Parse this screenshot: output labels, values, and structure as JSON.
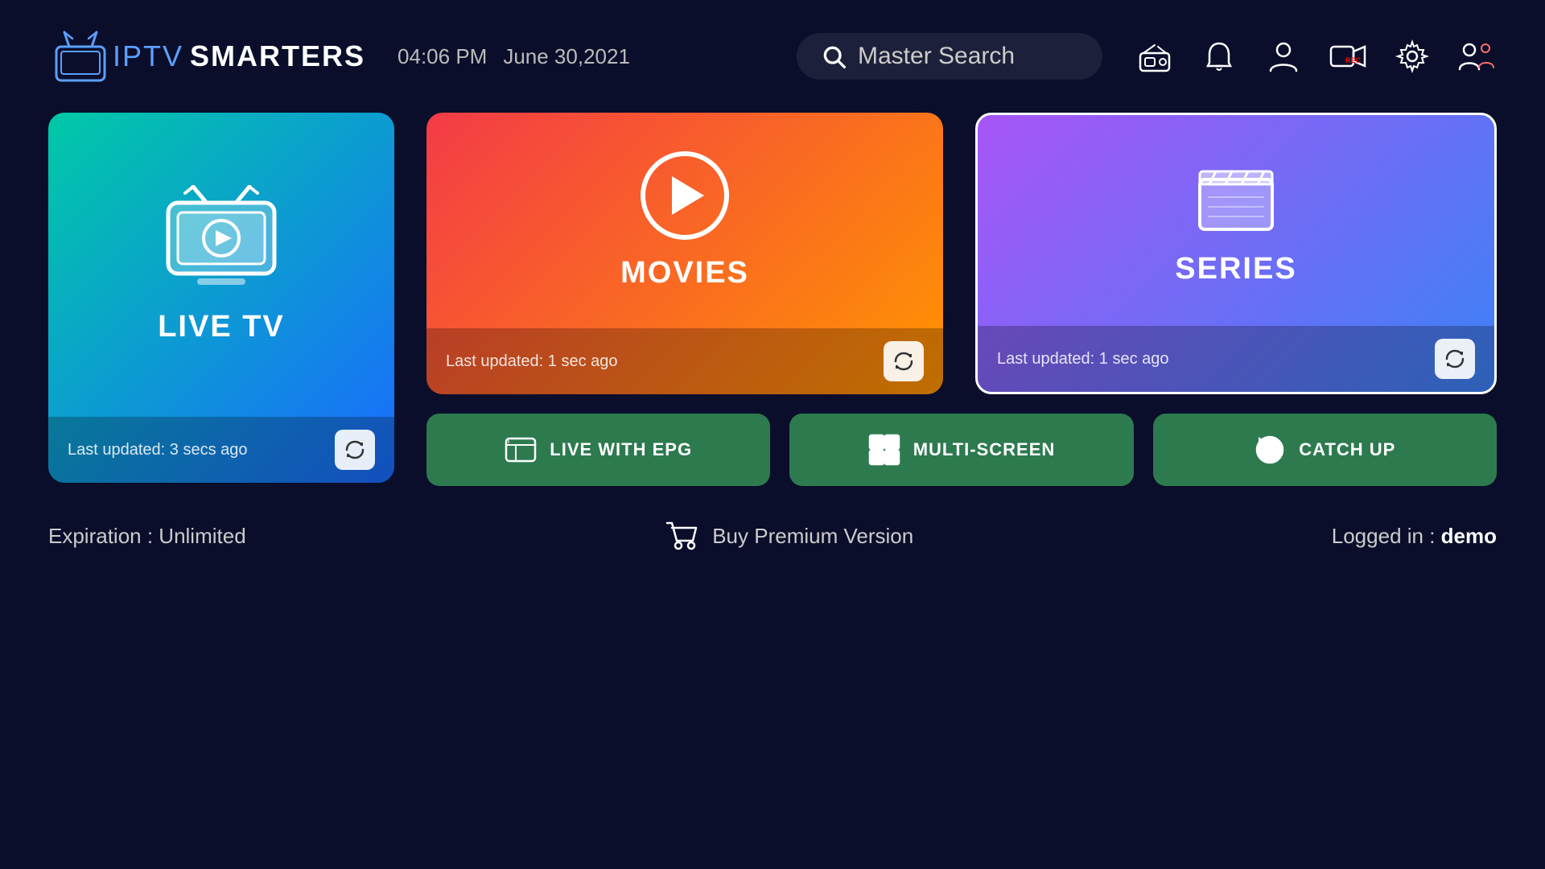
{
  "app": {
    "logo_text_iptv": "IPTV",
    "logo_text_smarters": "SMARTERS"
  },
  "header": {
    "time": "04:06 PM",
    "date": "June 30,2021",
    "search_placeholder": "Master Search",
    "icons": [
      {
        "name": "radio-icon",
        "label": "Radio"
      },
      {
        "name": "notifications-icon",
        "label": "Notifications"
      },
      {
        "name": "profile-icon",
        "label": "Profile"
      },
      {
        "name": "recording-icon",
        "label": "Recording"
      },
      {
        "name": "settings-icon",
        "label": "Settings"
      },
      {
        "name": "users-icon",
        "label": "Users"
      }
    ]
  },
  "cards": {
    "live_tv": {
      "label": "LIVE TV",
      "last_updated": "Last updated: 3 secs ago"
    },
    "movies": {
      "label": "MOVIES",
      "last_updated": "Last updated: 1 sec ago"
    },
    "series": {
      "label": "SERIES",
      "last_updated": "Last updated: 1 sec ago"
    }
  },
  "bottom_buttons": {
    "live_epg": "LIVE WITH EPG",
    "multi_screen": "MULTI-SCREEN",
    "catch_up": "CATCH UP"
  },
  "footer": {
    "expiration": "Expiration : Unlimited",
    "buy_premium": "Buy Premium Version",
    "logged_in_label": "Logged in : ",
    "logged_in_user": "demo"
  }
}
